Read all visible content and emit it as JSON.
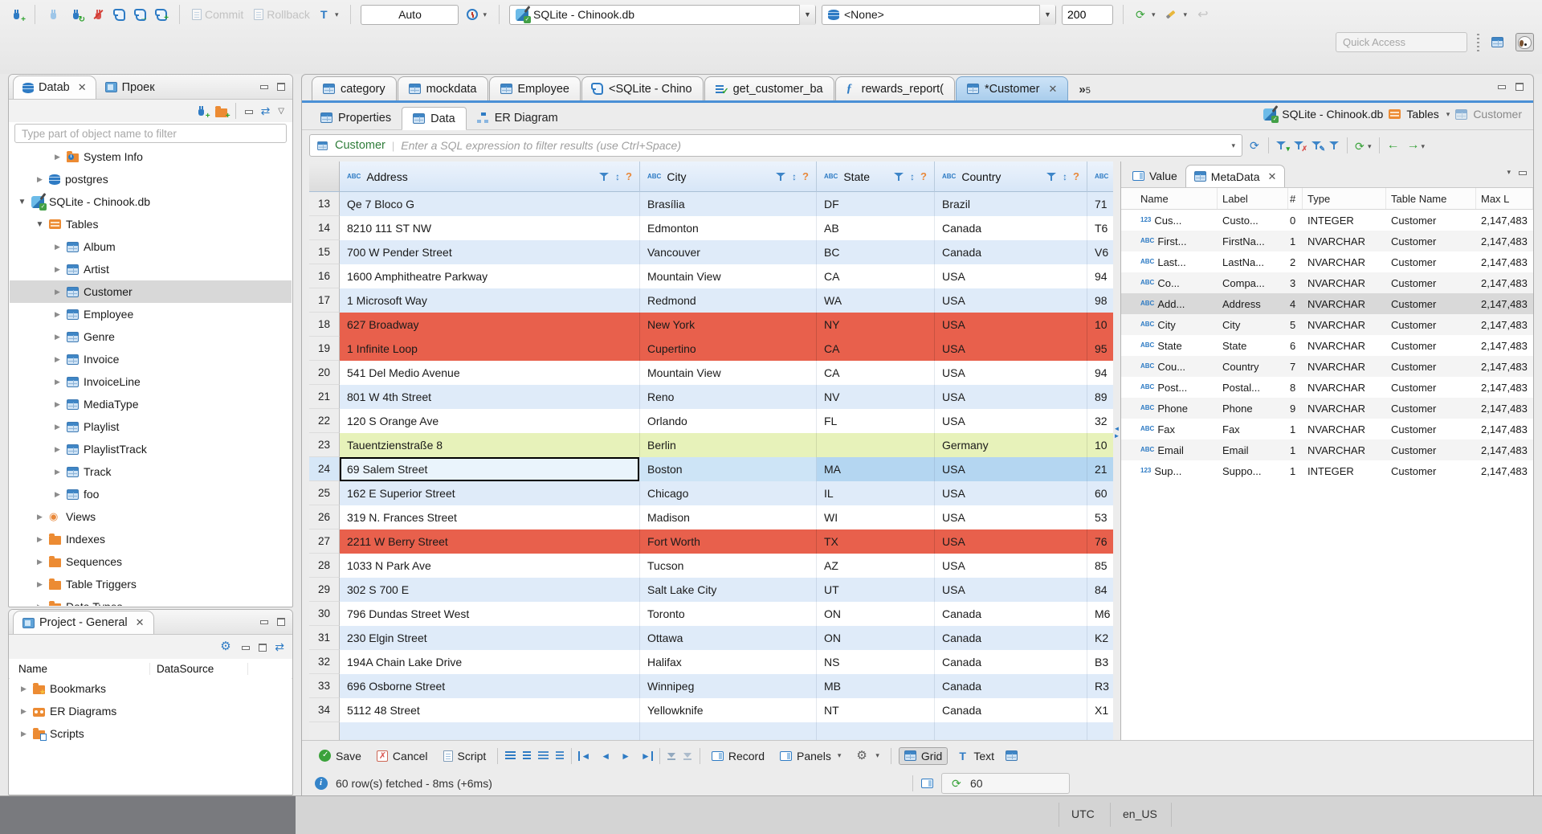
{
  "colors": {
    "accent": "#2e7bc4",
    "orange": "#ec8b33",
    "grid_stripe": "#dfebf9",
    "row_error": "#e8604c",
    "row_new": "#e7f2ba",
    "row_selected": "#b4d6f1",
    "active_tab": "#bcd9f3",
    "green": "#3aa33b"
  },
  "top_toolbar": {
    "commit_label": "Commit",
    "rollback_label": "Rollback",
    "auto_mode": "Auto",
    "connection": "SQLite - Chinook.db",
    "schema": "<None>",
    "fetch_size": "200",
    "quick_access_placeholder": "Quick Access"
  },
  "navigator": {
    "tabs": [
      {
        "label": "Datab"
      },
      {
        "label": "Проек"
      }
    ],
    "filter_placeholder": "Type part of object name to filter",
    "tree": [
      {
        "label": "System Info",
        "icon": "folder-info",
        "depth": 2,
        "state": "collapsed"
      },
      {
        "label": "postgres",
        "icon": "db-postgres",
        "depth": 1,
        "state": "collapsed"
      },
      {
        "label": "SQLite - Chinook.db",
        "icon": "sqlite",
        "depth": 0,
        "state": "expanded"
      },
      {
        "label": "Tables",
        "icon": "folder-table",
        "depth": 1,
        "state": "expanded"
      },
      {
        "label": "Album",
        "icon": "table",
        "depth": 2,
        "state": "collapsed"
      },
      {
        "label": "Artist",
        "icon": "table",
        "depth": 2,
        "state": "collapsed"
      },
      {
        "label": "Customer",
        "icon": "table",
        "depth": 2,
        "state": "collapsed",
        "selected": true
      },
      {
        "label": "Employee",
        "icon": "table",
        "depth": 2,
        "state": "collapsed"
      },
      {
        "label": "Genre",
        "icon": "table",
        "depth": 2,
        "state": "collapsed"
      },
      {
        "label": "Invoice",
        "icon": "table",
        "depth": 2,
        "state": "collapsed"
      },
      {
        "label": "InvoiceLine",
        "icon": "table",
        "depth": 2,
        "state": "collapsed"
      },
      {
        "label": "MediaType",
        "icon": "table",
        "depth": 2,
        "state": "collapsed"
      },
      {
        "label": "Playlist",
        "icon": "table",
        "depth": 2,
        "state": "collapsed"
      },
      {
        "label": "PlaylistTrack",
        "icon": "table",
        "depth": 2,
        "state": "collapsed"
      },
      {
        "label": "Track",
        "icon": "table",
        "depth": 2,
        "state": "collapsed"
      },
      {
        "label": "foo",
        "icon": "table",
        "depth": 2,
        "state": "collapsed"
      },
      {
        "label": "Views",
        "icon": "eye",
        "depth": 1,
        "state": "collapsed"
      },
      {
        "label": "Indexes",
        "icon": "folder",
        "depth": 1,
        "state": "collapsed"
      },
      {
        "label": "Sequences",
        "icon": "folder",
        "depth": 1,
        "state": "collapsed"
      },
      {
        "label": "Table Triggers",
        "icon": "folder",
        "depth": 1,
        "state": "collapsed"
      },
      {
        "label": "Data Types",
        "icon": "folder",
        "depth": 1,
        "state": "collapsed"
      }
    ]
  },
  "project_panel": {
    "title": "Project - General",
    "columns": [
      "Name",
      "DataSource"
    ],
    "items": [
      {
        "label": "Bookmarks",
        "icon": "folder-bookmark"
      },
      {
        "label": "ER Diagrams",
        "icon": "er-diagram"
      },
      {
        "label": "Scripts",
        "icon": "folder-script"
      }
    ]
  },
  "editor_tabs": [
    {
      "label": "category",
      "icon": "table"
    },
    {
      "label": "mockdata",
      "icon": "table"
    },
    {
      "label": "Employee",
      "icon": "table"
    },
    {
      "label": "<SQLite - Chino",
      "icon": "sql-scroll"
    },
    {
      "label": "get_customer_ba",
      "icon": "sql-script"
    },
    {
      "label": "rewards_report(",
      "icon": "function"
    },
    {
      "label": "*Customer",
      "icon": "table",
      "active": true,
      "closable": true
    }
  ],
  "tab_overflow_count": "5",
  "result_header": {
    "tabs": [
      {
        "label": "Properties"
      },
      {
        "label": "Data",
        "active": true
      },
      {
        "label": "ER Diagram"
      }
    ],
    "breadcrumb": [
      {
        "label": "SQLite - Chinook.db",
        "icon": "sqlite"
      },
      {
        "label": "Tables",
        "icon": "folder-table"
      },
      {
        "label": "Customer",
        "icon": "table"
      }
    ]
  },
  "filter_bar": {
    "entity": "Customer",
    "placeholder": "Enter a SQL expression to filter results (use Ctrl+Space)"
  },
  "grid": {
    "columns": [
      {
        "key": "address",
        "label": "Address",
        "type": "ABC"
      },
      {
        "key": "city",
        "label": "City",
        "type": "ABC"
      },
      {
        "key": "state",
        "label": "State",
        "type": "ABC"
      },
      {
        "key": "country",
        "label": "Country",
        "type": "ABC"
      },
      {
        "key": "extra",
        "label": "",
        "type": "ABC"
      }
    ],
    "rows": [
      {
        "num": "13",
        "address": "Qe 7 Bloco G",
        "city": "Brasília",
        "state": "DF",
        "country": "Brazil",
        "extra": "71",
        "style": "stripe"
      },
      {
        "num": "14",
        "address": "8210 111 ST NW",
        "city": "Edmonton",
        "state": "AB",
        "country": "Canada",
        "extra": "T6",
        "style": "plain"
      },
      {
        "num": "15",
        "address": "700 W Pender Street",
        "city": "Vancouver",
        "state": "BC",
        "country": "Canada",
        "extra": "V6",
        "style": "stripe"
      },
      {
        "num": "16",
        "address": "1600 Amphitheatre Parkway",
        "city": "Mountain View",
        "state": "CA",
        "country": "USA",
        "extra": "94",
        "style": "plain"
      },
      {
        "num": "17",
        "address": "1 Microsoft Way",
        "city": "Redmond",
        "state": "WA",
        "country": "USA",
        "extra": "98",
        "style": "stripe"
      },
      {
        "num": "18",
        "address": "627 Broadway",
        "city": "New York",
        "state": "NY",
        "country": "USA",
        "extra": "10",
        "style": "error"
      },
      {
        "num": "19",
        "address": "1 Infinite Loop",
        "city": "Cupertino",
        "state": "CA",
        "country": "USA",
        "extra": "95",
        "style": "error"
      },
      {
        "num": "20",
        "address": "541 Del Medio Avenue",
        "city": "Mountain View",
        "state": "CA",
        "country": "USA",
        "extra": "94",
        "style": "plain"
      },
      {
        "num": "21",
        "address": "801 W 4th Street",
        "city": "Reno",
        "state": "NV",
        "country": "USA",
        "extra": "89",
        "style": "stripe"
      },
      {
        "num": "22",
        "address": "120 S Orange Ave",
        "city": "Orlando",
        "state": "FL",
        "country": "USA",
        "extra": "32",
        "style": "plain"
      },
      {
        "num": "23",
        "address": "Tauentzienstraße 8",
        "city": "Berlin",
        "state": "",
        "country": "Germany",
        "extra": "10",
        "style": "new"
      },
      {
        "num": "24",
        "address": "69 Salem Street",
        "city": "Boston",
        "state": "MA",
        "country": "USA",
        "extra": "21",
        "style": "selected"
      },
      {
        "num": "25",
        "address": "162 E Superior Street",
        "city": "Chicago",
        "state": "IL",
        "country": "USA",
        "extra": "60",
        "style": "stripe"
      },
      {
        "num": "26",
        "address": "319 N. Frances Street",
        "city": "Madison",
        "state": "WI",
        "country": "USA",
        "extra": "53",
        "style": "plain"
      },
      {
        "num": "27",
        "address": "2211 W Berry Street",
        "city": "Fort Worth",
        "state": "TX",
        "country": "USA",
        "extra": "76",
        "style": "error"
      },
      {
        "num": "28",
        "address": "1033 N Park Ave",
        "city": "Tucson",
        "state": "AZ",
        "country": "USA",
        "extra": "85",
        "style": "plain"
      },
      {
        "num": "29",
        "address": "302 S 700 E",
        "city": "Salt Lake City",
        "state": "UT",
        "country": "USA",
        "extra": "84",
        "style": "stripe"
      },
      {
        "num": "30",
        "address": "796 Dundas Street West",
        "city": "Toronto",
        "state": "ON",
        "country": "Canada",
        "extra": "M6",
        "style": "plain"
      },
      {
        "num": "31",
        "address": "230 Elgin Street",
        "city": "Ottawa",
        "state": "ON",
        "country": "Canada",
        "extra": "K2",
        "style": "stripe"
      },
      {
        "num": "32",
        "address": "194A Chain Lake Drive",
        "city": "Halifax",
        "state": "NS",
        "country": "Canada",
        "extra": "B3",
        "style": "plain"
      },
      {
        "num": "33",
        "address": "696 Osborne Street",
        "city": "Winnipeg",
        "state": "MB",
        "country": "Canada",
        "extra": "R3",
        "style": "stripe"
      },
      {
        "num": "34",
        "address": "5112 48 Street",
        "city": "Yellowknife",
        "state": "NT",
        "country": "Canada",
        "extra": "X1",
        "style": "plain"
      }
    ]
  },
  "metadata_panel": {
    "tabs": [
      {
        "label": "Value"
      },
      {
        "label": "MetaData",
        "active": true,
        "closable": true
      }
    ],
    "columns": [
      "Name",
      "Label",
      "#",
      "Type",
      "Table Name",
      "Max L"
    ],
    "rows": [
      {
        "kind": "123",
        "name": "Cus...",
        "label": "Custo...",
        "ord": "0",
        "type": "INTEGER",
        "table": "Customer",
        "max": "2,147,483"
      },
      {
        "kind": "ABC",
        "name": "First...",
        "label": "FirstNa...",
        "ord": "1",
        "type": "NVARCHAR",
        "table": "Customer",
        "max": "2,147,483"
      },
      {
        "kind": "ABC",
        "name": "Last...",
        "label": "LastNa...",
        "ord": "2",
        "type": "NVARCHAR",
        "table": "Customer",
        "max": "2,147,483"
      },
      {
        "kind": "ABC",
        "name": "Co...",
        "label": "Compa...",
        "ord": "3",
        "type": "NVARCHAR",
        "table": "Customer",
        "max": "2,147,483"
      },
      {
        "kind": "ABC",
        "name": "Add...",
        "label": "Address",
        "ord": "4",
        "type": "NVARCHAR",
        "table": "Customer",
        "max": "2,147,483",
        "selected": true
      },
      {
        "kind": "ABC",
        "name": "City",
        "label": "City",
        "ord": "5",
        "type": "NVARCHAR",
        "table": "Customer",
        "max": "2,147,483"
      },
      {
        "kind": "ABC",
        "name": "State",
        "label": "State",
        "ord": "6",
        "type": "NVARCHAR",
        "table": "Customer",
        "max": "2,147,483"
      },
      {
        "kind": "ABC",
        "name": "Cou...",
        "label": "Country",
        "ord": "7",
        "type": "NVARCHAR",
        "table": "Customer",
        "max": "2,147,483"
      },
      {
        "kind": "ABC",
        "name": "Post...",
        "label": "Postal...",
        "ord": "8",
        "type": "NVARCHAR",
        "table": "Customer",
        "max": "2,147,483"
      },
      {
        "kind": "ABC",
        "name": "Phone",
        "label": "Phone",
        "ord": "9",
        "type": "NVARCHAR",
        "table": "Customer",
        "max": "2,147,483"
      },
      {
        "kind": "ABC",
        "name": "Fax",
        "label": "Fax",
        "ord": "1",
        "type": "NVARCHAR",
        "table": "Customer",
        "max": "2,147,483"
      },
      {
        "kind": "ABC",
        "name": "Email",
        "label": "Email",
        "ord": "1",
        "type": "NVARCHAR",
        "table": "Customer",
        "max": "2,147,483"
      },
      {
        "kind": "123",
        "name": "Sup...",
        "label": "Suppo...",
        "ord": "1",
        "type": "INTEGER",
        "table": "Customer",
        "max": "2,147,483"
      }
    ]
  },
  "bottom_toolbar": {
    "save": "Save",
    "cancel": "Cancel",
    "script": "Script",
    "record": "Record",
    "panels": "Panels",
    "grid": "Grid",
    "text": "Text"
  },
  "status_bar": {
    "message": "60 row(s) fetched - 8ms (+6ms)",
    "auto_refresh_value": "60"
  },
  "window_status": {
    "timezone": "UTC",
    "locale": "en_US"
  }
}
